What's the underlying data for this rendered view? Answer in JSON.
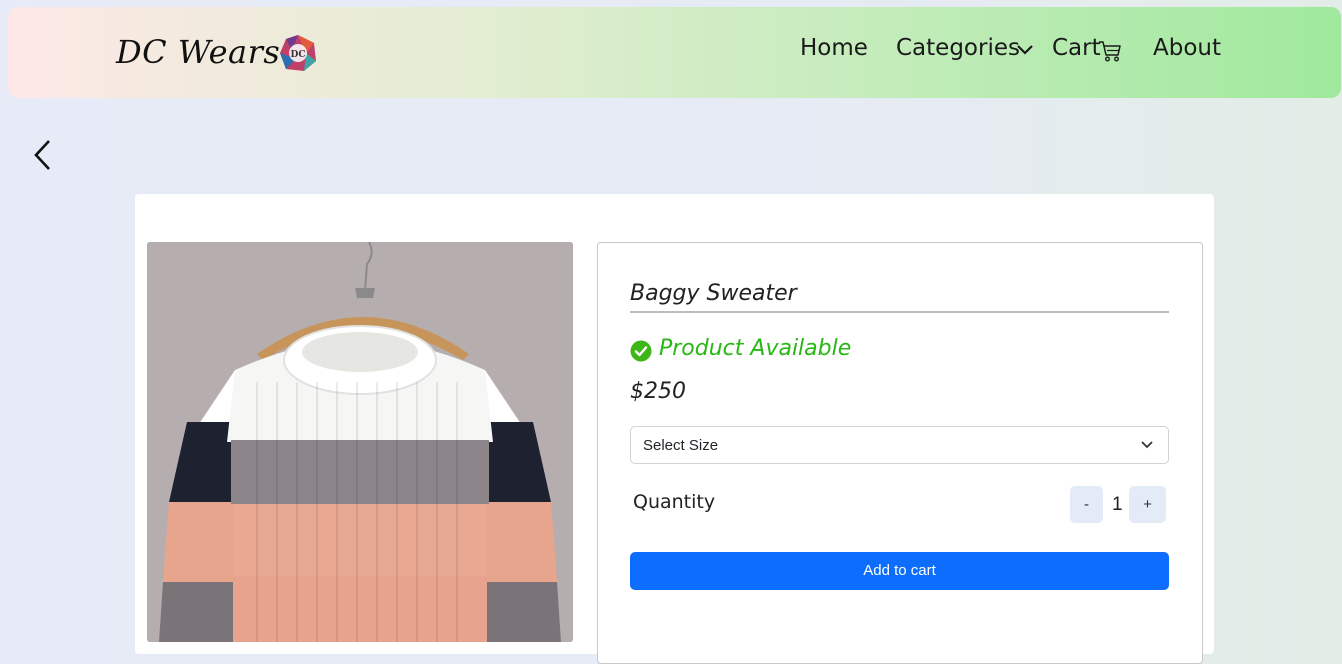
{
  "brand": {
    "name": "DC Wears",
    "logo_text": "DC"
  },
  "nav": {
    "home": "Home",
    "categories": "Categories",
    "cart": "Cart",
    "about": "About"
  },
  "product": {
    "name": "Baggy Sweater",
    "availability": "Product Available",
    "price": "$250",
    "size_select": {
      "selected": "Select Size"
    },
    "quantity_label": "Quantity",
    "quantity_value": "1",
    "minus_label": "-",
    "plus_label": "+",
    "add_to_cart_label": "Add to cart"
  },
  "colors": {
    "accent_blue": "#0d6efd",
    "available_green": "#28b714"
  },
  "icons": {
    "back": "chevron-left-icon",
    "categories_dropdown": "chevron-down-icon",
    "cart": "shopping-cart-icon",
    "availability": "check-circle-icon",
    "select": "chevron-down-icon"
  }
}
